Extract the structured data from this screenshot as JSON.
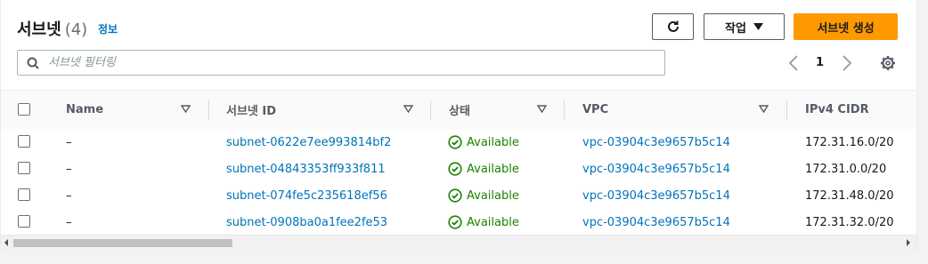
{
  "header": {
    "title": "서브넷",
    "count": "(4)",
    "info_link": "정보",
    "actions_label": "작업",
    "create_label": "서브넷 생성"
  },
  "search": {
    "placeholder": "서브넷 필터링",
    "value": ""
  },
  "pagination": {
    "current_page": "1"
  },
  "table": {
    "columns": [
      "Name",
      "서브넷 ID",
      "상태",
      "VPC",
      "IPv4 CIDR"
    ],
    "rows": [
      {
        "name": "–",
        "subnet_id": "subnet-0622e7ee993814bf2",
        "status": "Available",
        "vpc": "vpc-03904c3e9657b5c14",
        "cidr": "172.31.16.0/20"
      },
      {
        "name": "–",
        "subnet_id": "subnet-04843353ff933f811",
        "status": "Available",
        "vpc": "vpc-03904c3e9657b5c14",
        "cidr": "172.31.0.0/20"
      },
      {
        "name": "–",
        "subnet_id": "subnet-074fe5c235618ef56",
        "status": "Available",
        "vpc": "vpc-03904c3e9657b5c14",
        "cidr": "172.31.48.0/20"
      },
      {
        "name": "–",
        "subnet_id": "subnet-0908ba0a1fee2fe53",
        "status": "Available",
        "vpc": "vpc-03904c3e9657b5c14",
        "cidr": "172.31.32.0/20"
      }
    ]
  },
  "colors": {
    "primary": "#ff9900",
    "link": "#0073bb",
    "success": "#1d8102"
  },
  "icons": [
    "refresh-icon",
    "caret-down-icon",
    "search-icon",
    "chevron-left-icon",
    "chevron-right-icon",
    "gear-icon",
    "sort-icon",
    "status-ok-icon"
  ]
}
